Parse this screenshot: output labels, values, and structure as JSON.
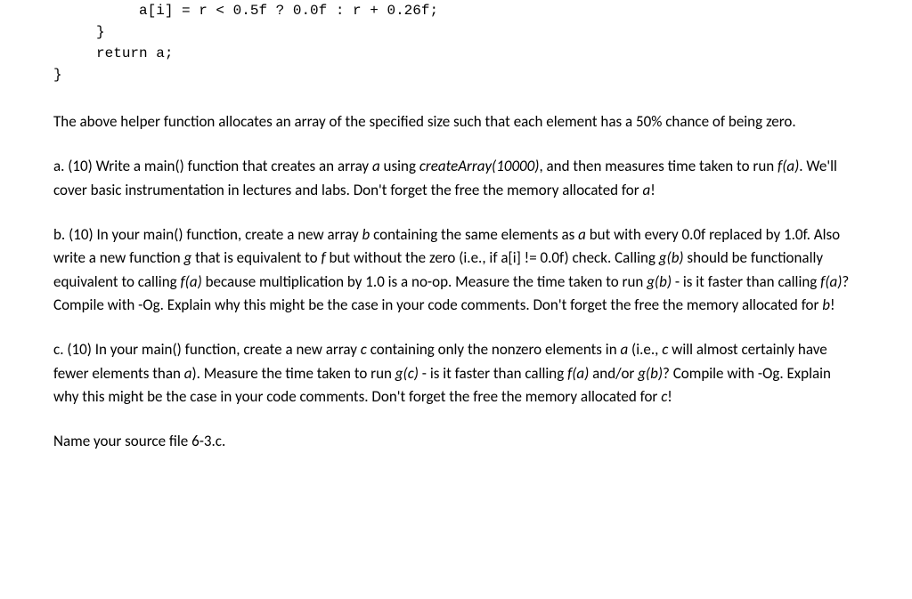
{
  "code": {
    "line1": "          a[i] = r < 0.5f ? 0.0f : r + 0.26f;",
    "line2": "     }",
    "line3": "     return a;",
    "line4": "}"
  },
  "intro": {
    "text": "The above helper function allocates an array of the specified size such that each element has a 50% chance of being zero."
  },
  "part_a": {
    "seg1": "a. (10) Write a main() function that creates an array ",
    "a1": "a",
    "seg2": " using ",
    "call": "createArray(10000)",
    "seg3": ", and then measures time taken to run ",
    "fa": "f(a)",
    "seg4": ".  We'll cover basic instrumentation in lectures and labs.  Don't forget the free the memory allocated for ",
    "a2": "a",
    "seg5": "!"
  },
  "part_b": {
    "seg1": "b. (10) In your main() function, create a new array ",
    "b1": "b",
    "seg2": " containing the same elements as ",
    "a1": "a",
    "seg3": " but with every 0.0f replaced by 1.0f.  Also write a new function ",
    "g1": "g",
    "seg4": " that is equivalent to ",
    "f1": "f",
    "seg5": " but without the zero (i.e., if a[i] != 0.0f) check.  Calling ",
    "gb": "g(b)",
    "seg6": " should be functionally equivalent to calling ",
    "fa": "f(a)",
    "seg7": " because multiplication by 1.0 is a no-op.  Measure the time taken to run ",
    "gb2": "g(b)",
    "seg8": " - is it faster than calling ",
    "fa2": "f(a)",
    "seg9": "?  Compile with -Og.  Explain why this might be the case in your code comments.  Don't forget the free the memory allocated for ",
    "b2": "b",
    "seg10": "!"
  },
  "part_c": {
    "seg1": "c. (10) In your main() function, create a new array ",
    "c1": "c",
    "seg2": " containing only the nonzero elements in ",
    "a1": "a",
    "seg3": " (i.e., ",
    "c2": "c",
    "seg4": " will almost certainly have fewer elements than ",
    "a2": "a",
    "seg5": ").  Measure the time taken to run ",
    "gc": "g(c)",
    "seg6": " - is it faster than calling ",
    "fa": "f(a)",
    "seg7": " and/or ",
    "gb": "g(b)",
    "seg8": "? Compile with -Og.  Explain why this might be the case in your code comments.  Don't forget the free the memory allocated for ",
    "c3": "c",
    "seg9": "!"
  },
  "footer": {
    "text": "Name your source file 6-3.c."
  }
}
